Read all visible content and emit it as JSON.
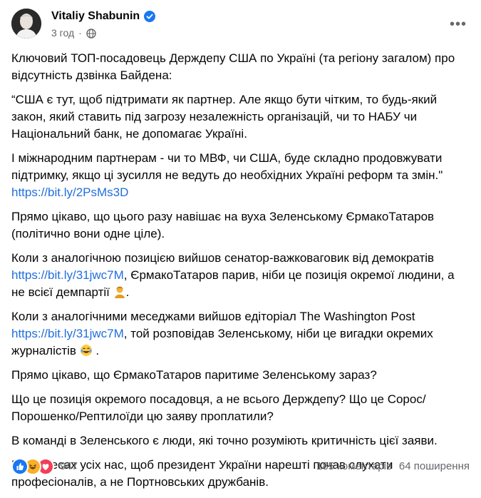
{
  "post": {
    "author": "Vitaliy Shabunin",
    "time": "3 год",
    "paragraphs": [
      [
        "Ключовий ТОП-посадовець Держдепу США по Україні (та регіону загалом) про відсутність дзвінка Байдена:"
      ],
      [
        "“США є тут, щоб підтримати як партнер. Але якщо бути чітким, то будь-який закон, який ставить під загрозу незалежність організацій, чи то НАБУ чи Національний банк, не допомагає Україні."
      ],
      [
        "І міжнародним партнерам - чи то МВФ, чи США, буде складно продовжувати підтримку, якщо ці зусилля не ведуть до необхідних Україні реформ та змін.\"",
        "https://bit.ly/2PsMs3D"
      ],
      [
        "Прямо цікаво, що цього разу навішає на вуха Зеленському ЄрмакоТатаров (політично вони одне ціле)."
      ],
      [
        "Коли з аналогічною позицією вийшов сенатор-важковаговик від демократів",
        "https://bit.ly/31jwc7M",
        ", ЄрмакоТатаров парив, ніби це позиція окремої людини, а не всієї демпартії ",
        "."
      ],
      [
        "Коли з аналогічними меседжами вийшов едіторіал The Washington Post",
        "https://bit.ly/31jwc7M",
        ", той  розповідав Зеленському, ніби це вигадки окремих журналістів ",
        " ."
      ],
      [
        "Прямо цікаво, що ЄрмакоТатаров паритиме Зеленському зараз?"
      ],
      [
        "Що це позиція окремого посадовця, а не всього Держдепу? Що це Сорос/ Порошенко/Рептилоїди цю заяву проплатили?"
      ],
      [
        "В команді в Зеленського є люди, які точно розуміють критичність цієї заяви."
      ],
      [
        "В інтересах усіх нас, щоб президент України нарешті почав слухати професіоналів, а не Портновських дружбанів."
      ]
    ]
  },
  "footer": {
    "reaction_count": "947",
    "comments": "185 коментарів",
    "shares": "64 поширення"
  },
  "colors": {
    "link": "#216fdb",
    "meta": "#65676b",
    "like": "#1877f2",
    "haha": "#f7b125",
    "love": "#f33e58"
  }
}
